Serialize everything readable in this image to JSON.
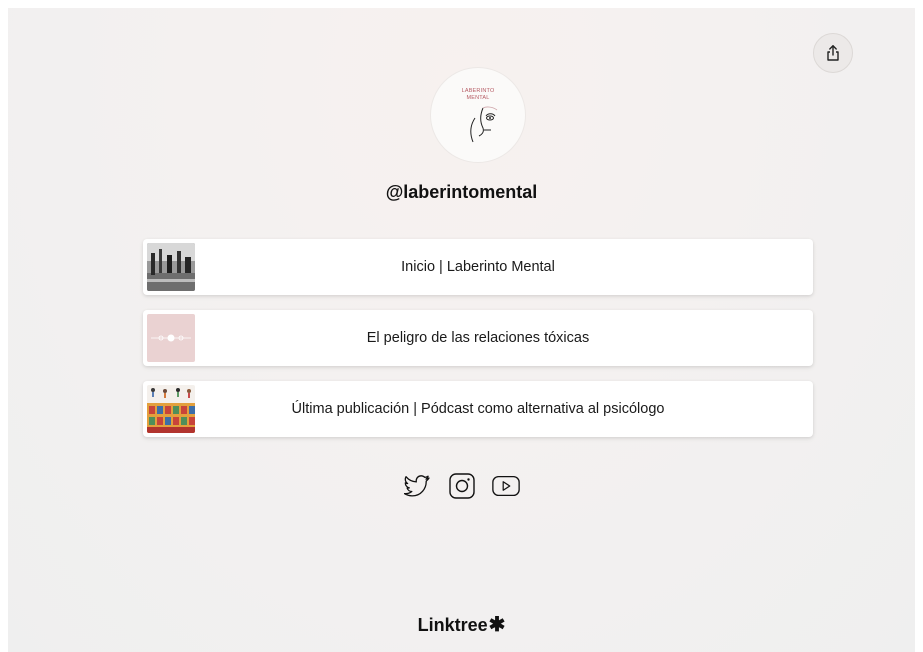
{
  "profile": {
    "handle": "@laberintomental",
    "avatar_text": "LABERINTO\nMENTAL"
  },
  "header": {
    "share_icon": "share-icon"
  },
  "links": [
    {
      "label": "Inicio | Laberinto Mental",
      "thumb": "street-photo-thumbnail"
    },
    {
      "label": "El peligro de las relaciones tóxicas",
      "thumb": "pink-graphic-thumbnail"
    },
    {
      "label": "Última publicación | Pódcast como alternativa al psicólogo",
      "thumb": "people-illustration-thumbnail"
    }
  ],
  "socials": [
    {
      "name": "twitter-icon"
    },
    {
      "name": "instagram-icon"
    },
    {
      "name": "youtube-icon"
    }
  ],
  "footer": {
    "brand": "Linktree",
    "brand_mark": "✱"
  },
  "colors": {
    "background": "#f3f1f0",
    "card": "#ffffff",
    "text": "#1a1a1a",
    "avatar_accent": "#b55a63"
  }
}
